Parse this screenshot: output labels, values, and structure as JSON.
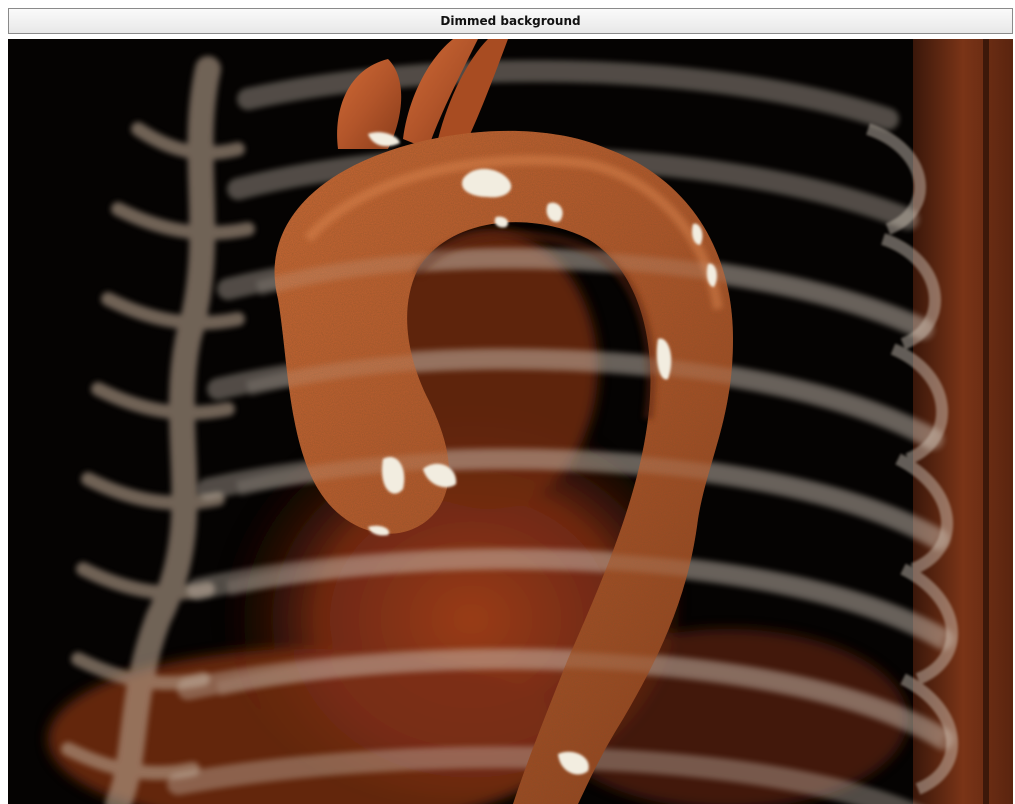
{
  "window": {
    "title": "Dimmed background"
  },
  "render": {
    "subject": "volume-rendered aorta with rib cage",
    "colors": {
      "background": "#050302",
      "vessel": "#b2552a",
      "vessel_highlight": "#d9753f",
      "vessel_shadow": "#6e2a10",
      "bone": "#c9bcae",
      "calcification": "#f2ede0",
      "tissue": "#7a2e14"
    }
  }
}
